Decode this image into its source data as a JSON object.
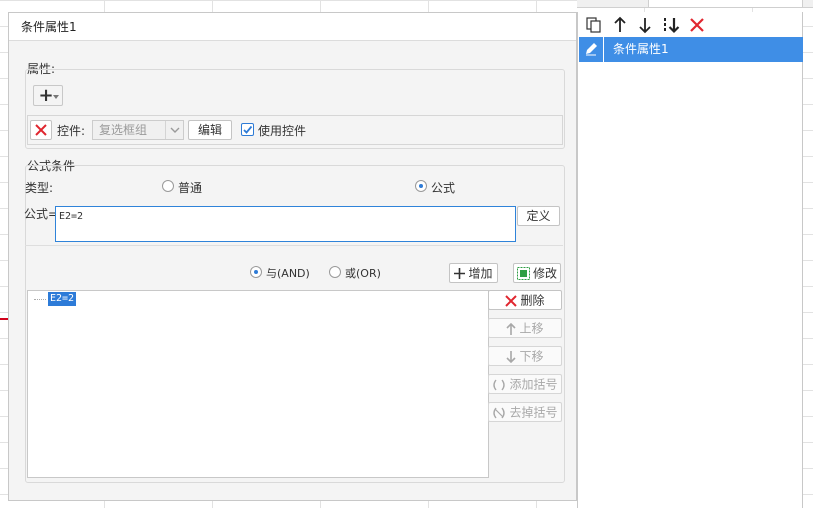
{
  "dialog": {
    "title": "条件属性1"
  },
  "attributes": {
    "group_label": "属性:",
    "add_symbol": "+",
    "control_label": "控件:",
    "control_value": "复选框组",
    "edit_button": "编辑",
    "use_control_label": "使用控件",
    "use_control_checked": true
  },
  "formula_condition": {
    "group_label": "公式条件",
    "type_label": "类型:",
    "type_options": [
      "普通",
      "公式"
    ],
    "type_selected": "公式",
    "formula_label": "公式=",
    "formula_value": "E2=2",
    "define_button": "定义",
    "logic_and": "与(AND)",
    "logic_or": "或(OR)",
    "logic_selected": "与(AND)",
    "add_button": "增加",
    "modify_button": "修改",
    "conditions": [
      "E2=2"
    ],
    "side_buttons": {
      "delete": "删除",
      "move_up": "上移",
      "move_down": "下移",
      "add_bracket": "添加括号",
      "remove_bracket": "去掉括号"
    }
  },
  "right_panel": {
    "items": [
      "条件属性1"
    ],
    "toolbar_icons": [
      "copy-icon",
      "arrow-up-icon",
      "arrow-down-icon",
      "move-bottom-icon",
      "delete-icon"
    ]
  },
  "colors": {
    "accent": "#2e7bd6",
    "selected_row": "#3f8ee6",
    "delete_red": "#e0262f",
    "modify_green": "#2f9e44"
  }
}
